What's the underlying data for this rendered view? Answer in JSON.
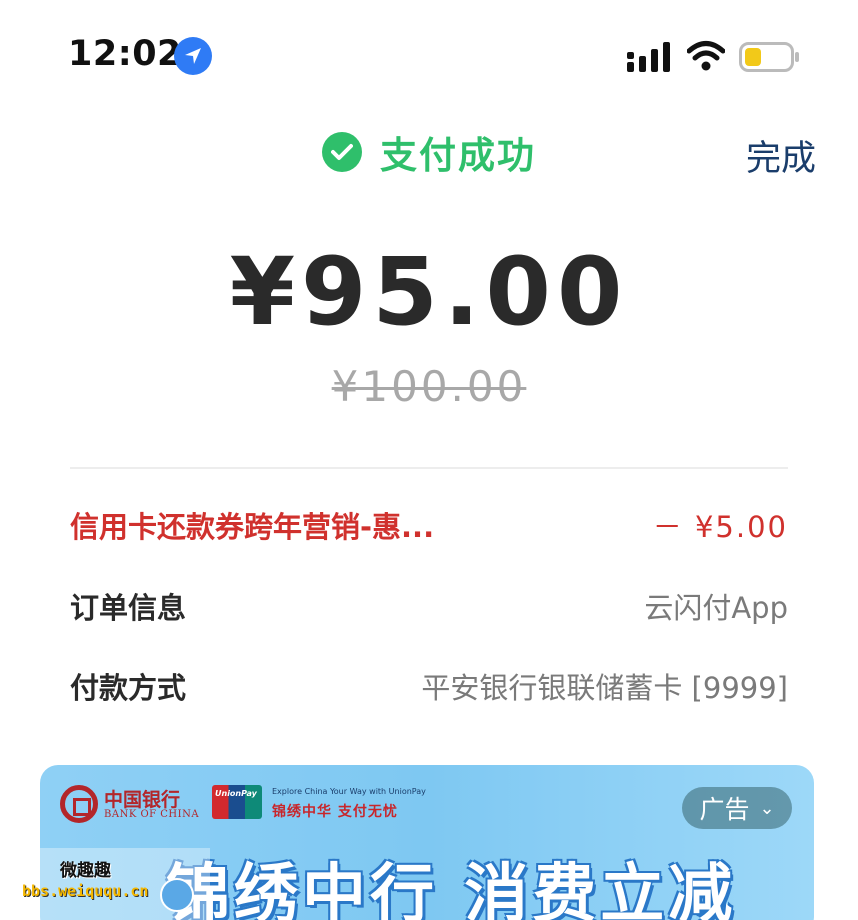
{
  "status_bar": {
    "time": "12:02",
    "icons": [
      "location-arrow-icon",
      "cellular-signal-icon",
      "wifi-icon",
      "battery-icon"
    ],
    "battery_color": "#f2c919"
  },
  "header": {
    "status_text": "支付成功",
    "status_color": "#2fbf6b",
    "done_label": "完成"
  },
  "payment": {
    "amount": "¥95.00",
    "original_amount": "¥100.00"
  },
  "details": {
    "promo": {
      "label": "信用卡还款券跨年营销-惠...",
      "value": "－ ¥5.00"
    },
    "order": {
      "label": "订单信息",
      "value": "云闪付App"
    },
    "payment_method": {
      "label": "付款方式",
      "value": "平安银行银联储蓄卡 [9999]"
    }
  },
  "ad": {
    "bank_name": "中国银行",
    "bank_name_en": "BANK OF CHINA",
    "unionpay_text": "UnionPay",
    "tagline_en": "Explore China Your Way with UnionPay",
    "tagline_cn": "锦绣中华 支付无忧",
    "tag_label": "广告",
    "headline": "锦绣中行 消费立减"
  },
  "watermark": {
    "name": "微趣趣",
    "url": "bbs.weiququ.cn"
  }
}
